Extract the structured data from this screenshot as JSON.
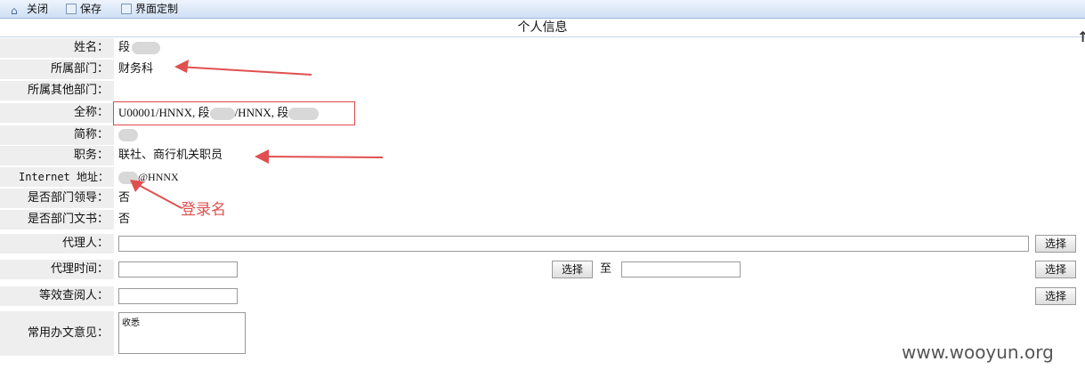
{
  "toolbar": {
    "close_label": "关闭",
    "save_label": "保存",
    "ui_custom_label": "界面定制"
  },
  "form_title": "个人信息",
  "fields": {
    "name_label": "姓名：",
    "name_value": "段",
    "dept_label": "所属部门：",
    "dept_value": "财务科",
    "other_dept_label": "所属其他部门：",
    "fullname_label": "全称：",
    "fullname_part1": "U00001/HNNX, 段",
    "fullname_part2": "/HNNX, 段",
    "short_label": "简称：",
    "position_label": "职务：",
    "position_value": "联社、商行机关职员",
    "internet_label": "Internet 地址：",
    "internet_value": "@HNNX",
    "is_leader_label": "是否部门领导：",
    "is_leader_value": "否",
    "is_secretary_label": "是否部门文书：",
    "is_secretary_value": "否",
    "agent_label": "代理人：",
    "agent_time_label": "代理时间：",
    "to_label": "至",
    "equiv_reader_label": "等效查阅人：",
    "common_opinion_label": "常用办文意见：",
    "common_opinion_value": "收悉"
  },
  "buttons": {
    "select": "选择"
  },
  "annotation": "登录名",
  "watermark": "www.wooyun.org",
  "colors": {
    "annotation_red": "#e05050",
    "label_bg": "#eeeeee",
    "toolbar_blue": "#cfe0f5"
  }
}
